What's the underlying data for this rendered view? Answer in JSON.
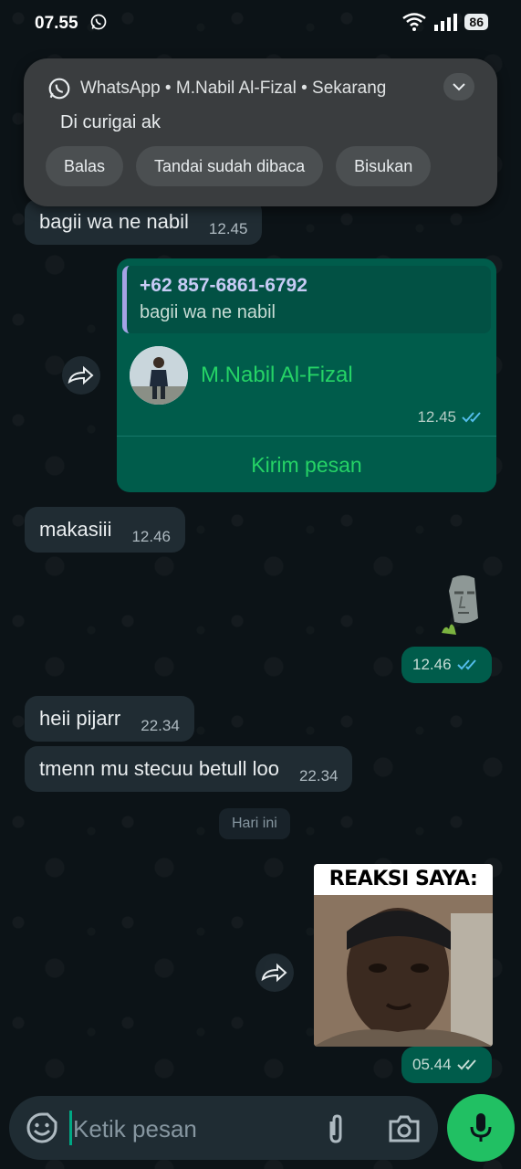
{
  "status_bar": {
    "time": "07.55",
    "battery": "86"
  },
  "notification": {
    "header": "WhatsApp • M.Nabil Al-Fizal • Sekarang",
    "message": "Di curigai ak",
    "actions": [
      "Balas",
      "Tandai sudah dibaca",
      "Bisukan"
    ]
  },
  "messages": {
    "m1": {
      "text": "bagii wa ne nabil",
      "time": "12.45"
    },
    "contact": {
      "quote_phone": "+62 857-6861-6792",
      "quote_text": "bagii wa ne nabil",
      "name": "M.Nabil Al-Fizal",
      "time": "12.45",
      "send_label": "Kirim pesan"
    },
    "m2": {
      "text": "makasiii",
      "time": "12.46"
    },
    "sticker_time": "12.46",
    "m3": {
      "text": "heii pijarr",
      "time": "22.34"
    },
    "m4": {
      "text": "tmenn mu stecuu betull loo",
      "time": "22.34"
    },
    "date_divider": "Hari ini",
    "gif": {
      "caption": "REAKSI SAYA:",
      "time": "05.44"
    }
  },
  "composer": {
    "placeholder": "Ketik pesan"
  },
  "colors": {
    "accent": "#25d366",
    "outgoing": "#005c4b",
    "incoming": "#202c33",
    "read_ticks": "#53bdeb"
  }
}
